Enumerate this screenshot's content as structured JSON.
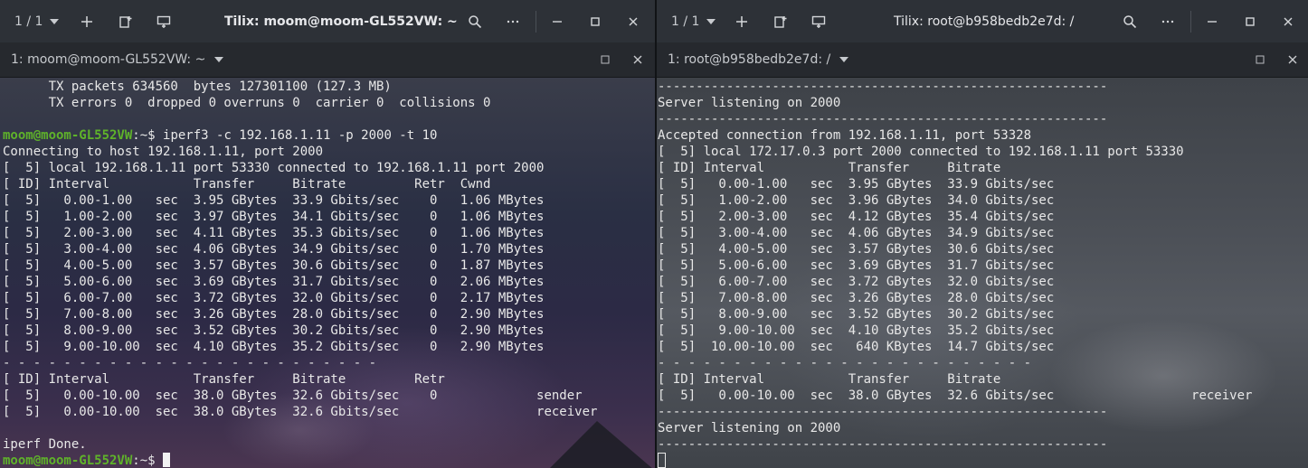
{
  "left": {
    "session_count": "1 / 1",
    "window_title": "Tilix: moom@moom-GL552VW: ~",
    "tab_title": "1: moom@moom-GL552VW: ~",
    "prompt_text": "moom@moom-GL552VW",
    "lines": [
      "      TX packets 634560  bytes 127301100 (127.3 MB)",
      "      TX errors 0  dropped 0 overruns 0  carrier 0  collisions 0",
      "",
      "",
      "Connecting to host 192.168.1.11, port 2000",
      "[  5] local 192.168.1.11 port 53330 connected to 192.168.1.11 port 2000",
      "[ ID] Interval           Transfer     Bitrate         Retr  Cwnd",
      "[  5]   0.00-1.00   sec  3.95 GBytes  33.9 Gbits/sec    0   1.06 MBytes",
      "[  5]   1.00-2.00   sec  3.97 GBytes  34.1 Gbits/sec    0   1.06 MBytes",
      "[  5]   2.00-3.00   sec  4.11 GBytes  35.3 Gbits/sec    0   1.06 MBytes",
      "[  5]   3.00-4.00   sec  4.06 GBytes  34.9 Gbits/sec    0   1.70 MBytes",
      "[  5]   4.00-5.00   sec  3.57 GBytes  30.6 Gbits/sec    0   1.87 MBytes",
      "[  5]   5.00-6.00   sec  3.69 GBytes  31.7 Gbits/sec    0   2.06 MBytes",
      "[  5]   6.00-7.00   sec  3.72 GBytes  32.0 Gbits/sec    0   2.17 MBytes",
      "[  5]   7.00-8.00   sec  3.26 GBytes  28.0 Gbits/sec    0   2.90 MBytes",
      "[  5]   8.00-9.00   sec  3.52 GBytes  30.2 Gbits/sec    0   2.90 MBytes",
      "[  5]   9.00-10.00  sec  4.10 GBytes  35.2 Gbits/sec    0   2.90 MBytes",
      "- - - - - - - - - - - - - - - - - - - - - - - - -",
      "[ ID] Interval           Transfer     Bitrate         Retr",
      "[  5]   0.00-10.00  sec  38.0 GBytes  32.6 Gbits/sec    0             sender",
      "[  5]   0.00-10.00  sec  38.0 GBytes  32.6 Gbits/sec                  receiver",
      "",
      "iperf Done.",
      ""
    ],
    "command_line_suffix": ":~$ iperf3 -c 192.168.1.11 -p 2000 -t 10",
    "final_prompt_suffix": ":~$"
  },
  "right": {
    "session_count": "1 / 1",
    "window_title": "Tilix: root@b958bedb2e7d: /",
    "tab_title": "1: root@b958bedb2e7d: /",
    "lines": [
      "-----------------------------------------------------------",
      "Server listening on 2000",
      "-----------------------------------------------------------",
      "Accepted connection from 192.168.1.11, port 53328",
      "[  5] local 172.17.0.3 port 2000 connected to 192.168.1.11 port 53330",
      "[ ID] Interval           Transfer     Bitrate",
      "[  5]   0.00-1.00   sec  3.95 GBytes  33.9 Gbits/sec",
      "[  5]   1.00-2.00   sec  3.96 GBytes  34.0 Gbits/sec",
      "[  5]   2.00-3.00   sec  4.12 GBytes  35.4 Gbits/sec",
      "[  5]   3.00-4.00   sec  4.06 GBytes  34.9 Gbits/sec",
      "[  5]   4.00-5.00   sec  3.57 GBytes  30.6 Gbits/sec",
      "[  5]   5.00-6.00   sec  3.69 GBytes  31.7 Gbits/sec",
      "[  5]   6.00-7.00   sec  3.72 GBytes  32.0 Gbits/sec",
      "[  5]   7.00-8.00   sec  3.26 GBytes  28.0 Gbits/sec",
      "[  5]   8.00-9.00   sec  3.52 GBytes  30.2 Gbits/sec",
      "[  5]   9.00-10.00  sec  4.10 GBytes  35.2 Gbits/sec",
      "[  5]  10.00-10.00  sec   640 KBytes  14.7 Gbits/sec",
      "- - - - - - - - - - - - - - - - - - - - - - - - -",
      "[ ID] Interval           Transfer     Bitrate",
      "[  5]   0.00-10.00  sec  38.0 GBytes  32.6 Gbits/sec                  receiver",
      "-----------------------------------------------------------",
      "Server listening on 2000",
      "-----------------------------------------------------------",
      ""
    ]
  },
  "colors": {
    "titlebar": "#2d3137",
    "tabbar": "#26292e",
    "prompt": "#5fb32a",
    "text": "#e8e8e8"
  },
  "icons": [
    "chevron-down-icon",
    "plus-icon",
    "add-terminal-right-icon",
    "add-terminal-down-icon",
    "search-icon",
    "more-icon",
    "minimize-icon",
    "maximize-icon",
    "close-icon"
  ]
}
